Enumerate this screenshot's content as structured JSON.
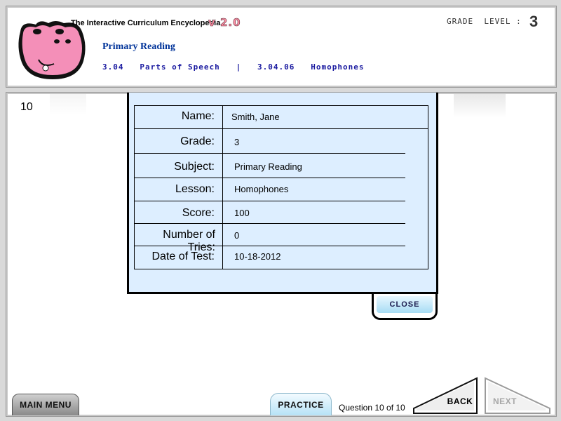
{
  "header": {
    "app_title": "The Interactive Curriculum Encyclopedia",
    "version": "v 2.0",
    "subject": "Primary Reading",
    "breadcrumb": "3.04   Parts of Speech   |   3.04.06   Homophones",
    "grade_label": "GRADE  LEVEL :",
    "grade_value": "3"
  },
  "content": {
    "question_number": "10"
  },
  "report": {
    "rows": [
      {
        "label": "Name:",
        "value": "Smith, Jane"
      },
      {
        "label": "Grade:",
        "value": "3"
      },
      {
        "label": "Subject:",
        "value": "Primary Reading"
      },
      {
        "label": "Lesson:",
        "value": "Homophones"
      },
      {
        "label": "Score:",
        "value": "100"
      },
      {
        "label": "Number of Tries:",
        "value": "0"
      },
      {
        "label": "Date of Test:",
        "value": "10-18-2012"
      }
    ],
    "close_label": "CLOSE"
  },
  "footer": {
    "main_menu": "MAIN MENU",
    "practice": "PRACTICE",
    "question_count": "Question 10 of 10",
    "back": "BACK",
    "next": "NEXT"
  },
  "colors": {
    "panel_bg": "#ddeeff",
    "subject_blue": "#003399",
    "logo_pink": "#f48fb8"
  }
}
